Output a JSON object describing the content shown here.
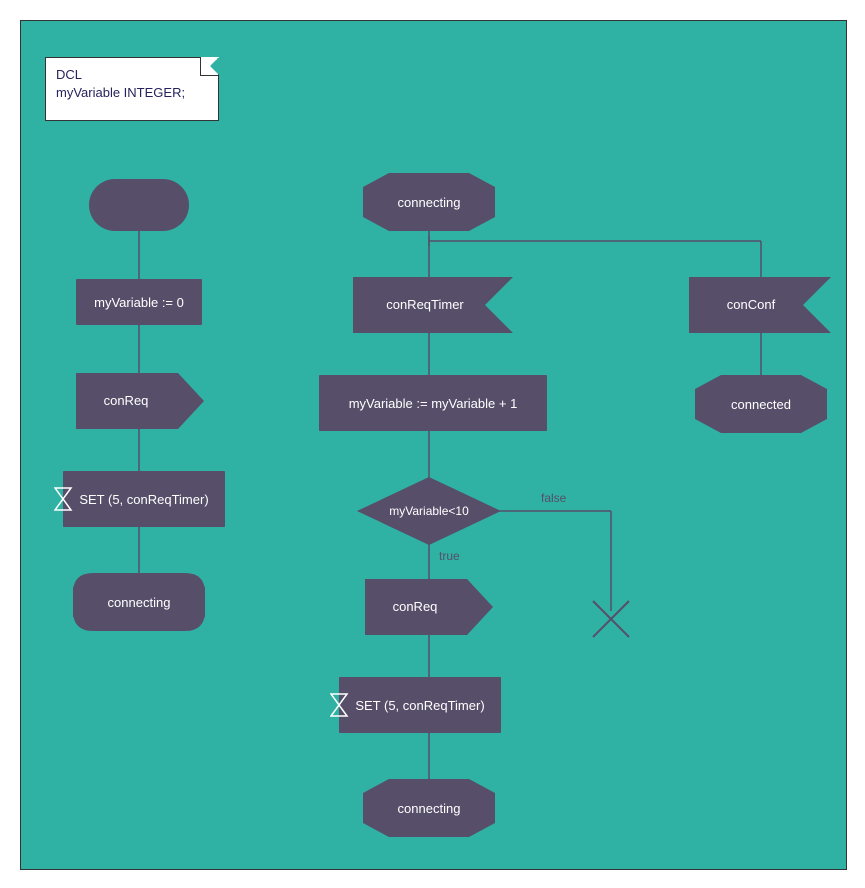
{
  "note": {
    "line1": "DCL",
    "line2": "myVariable INTEGER;"
  },
  "col1": {
    "task1": "myVariable := 0",
    "output1": "conReq",
    "task2": "SET (5, conReqTimer)",
    "state1": "connecting"
  },
  "col2": {
    "state_top": "connecting",
    "input1": "conReqTimer",
    "task1": "myVariable := myVariable + 1",
    "decision": "myVariable<10",
    "true_label": "true",
    "false_label": "false",
    "output1": "conReq",
    "task2": "SET (5, conReqTimer)",
    "state_bottom": "connecting"
  },
  "col3": {
    "input1": "conConf",
    "state1": "connected"
  }
}
